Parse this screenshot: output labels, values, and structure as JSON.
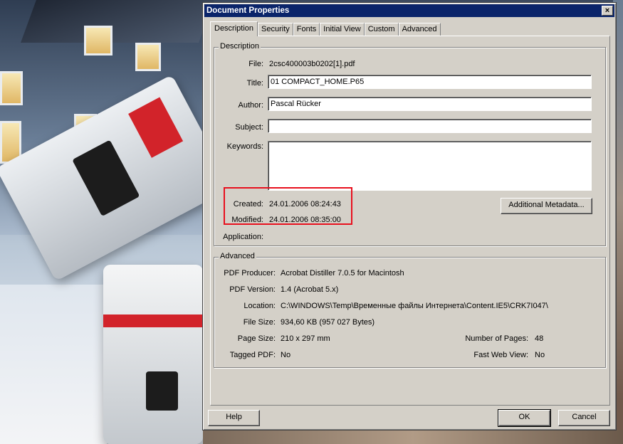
{
  "window": {
    "title": "Document Properties",
    "close_label": "×"
  },
  "tabs": [
    {
      "label": "Description"
    },
    {
      "label": "Security"
    },
    {
      "label": "Fonts"
    },
    {
      "label": "Initial View"
    },
    {
      "label": "Custom"
    },
    {
      "label": "Advanced"
    }
  ],
  "description": {
    "group_label": "Description",
    "file_label": "File:",
    "file_value": "2csc400003b0202[1].pdf",
    "title_label": "Title:",
    "title_value": "01 COMPACT_HOME.P65",
    "author_label": "Author:",
    "author_value": "Pascal Rücker",
    "subject_label": "Subject:",
    "subject_value": "",
    "keywords_label": "Keywords:",
    "keywords_value": "",
    "created_label": "Created:",
    "created_value": "24.01.2006 08:24:43",
    "modified_label": "Modified:",
    "modified_value": "24.01.2006 08:35:00",
    "application_label": "Application:",
    "application_value": "",
    "metadata_button": "Additional Metadata..."
  },
  "advanced": {
    "group_label": "Advanced",
    "producer_label": "PDF Producer:",
    "producer_value": "Acrobat Distiller 7.0.5 for Macintosh",
    "version_label": "PDF Version:",
    "version_value": "1.4 (Acrobat 5.x)",
    "location_label": "Location:",
    "location_value": "C:\\WINDOWS\\Temp\\Временные файлы Интернета\\Content.IE5\\CRK7I047\\",
    "filesize_label": "File Size:",
    "filesize_value": "934,60 KB (957 027 Bytes)",
    "pagesize_label": "Page Size:",
    "pagesize_value": "210 x 297 mm",
    "pages_label": "Number of Pages:",
    "pages_value": "48",
    "tagged_label": "Tagged PDF:",
    "tagged_value": "No",
    "fastweb_label": "Fast Web View:",
    "fastweb_value": "No"
  },
  "footer": {
    "help": "Help",
    "ok": "OK",
    "cancel": "Cancel"
  },
  "colors": {
    "titlebar": "#0a246a",
    "highlight": "#e8101e",
    "dialog": "#d4d0c8"
  }
}
